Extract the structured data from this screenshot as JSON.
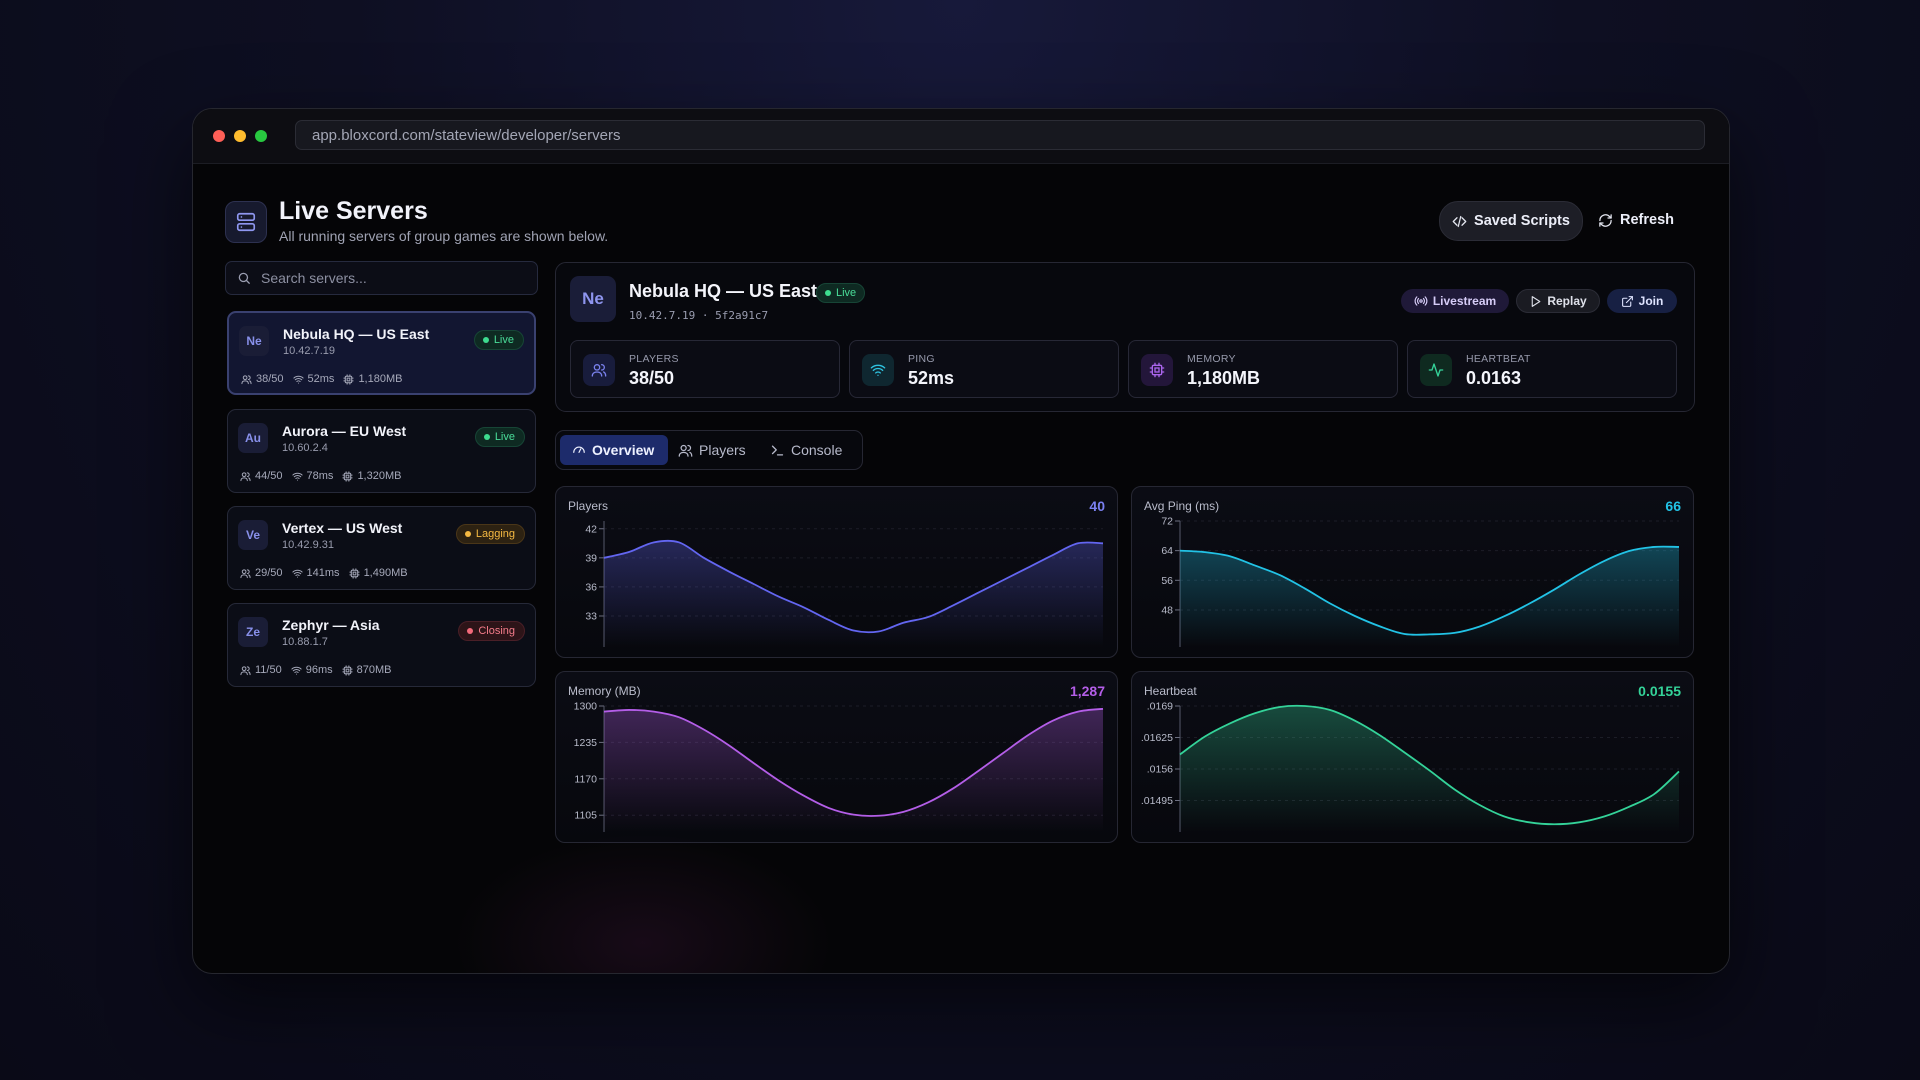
{
  "browser": {
    "url": "app.bloxcord.com/stateview/developer/servers"
  },
  "header": {
    "title": "Live Servers",
    "subtitle": "All running servers of group games are shown below.",
    "saved_scripts_label": "Saved Scripts",
    "refresh_label": "Refresh"
  },
  "search": {
    "placeholder": "Search servers..."
  },
  "servers": [
    {
      "initials": "Ne",
      "name": "Nebula HQ — US East",
      "ip": "10.42.7.19",
      "status": "Live",
      "players": "38/50",
      "ping": "52ms",
      "memory": "1,180MB"
    },
    {
      "initials": "Au",
      "name": "Aurora — EU West",
      "ip": "10.60.2.4",
      "status": "Live",
      "players": "44/50",
      "ping": "78ms",
      "memory": "1,320MB"
    },
    {
      "initials": "Ve",
      "name": "Vertex — US West",
      "ip": "10.42.9.31",
      "status": "Lagging",
      "players": "29/50",
      "ping": "141ms",
      "memory": "1,490MB"
    },
    {
      "initials": "Ze",
      "name": "Zephyr — Asia",
      "ip": "10.88.1.7",
      "status": "Closing",
      "players": "11/50",
      "ping": "96ms",
      "memory": "870MB"
    }
  ],
  "detail": {
    "initials": "Ne",
    "name": "Nebula HQ — US East",
    "status": "Live",
    "meta": "10.42.7.19 · 5f2a91c7",
    "actions": {
      "livestream": "Livestream",
      "replay": "Replay",
      "join": "Join"
    },
    "stats": [
      {
        "label": "PLAYERS",
        "value": "38/50",
        "icon": "users-icon",
        "color": "#6d74e8"
      },
      {
        "label": "PING",
        "value": "52ms",
        "icon": "wifi-icon",
        "color": "#22b8d8"
      },
      {
        "label": "MEMORY",
        "value": "1,180MB",
        "icon": "chip-icon",
        "color": "#a35be8"
      },
      {
        "label": "HEARTBEAT",
        "value": "0.0163",
        "icon": "pulse-icon",
        "color": "#2fc98a"
      }
    ]
  },
  "tabs": [
    {
      "label": "Overview",
      "icon": "gauge-icon",
      "active": true
    },
    {
      "label": "Players",
      "icon": "users-icon",
      "active": false
    },
    {
      "label": "Console",
      "icon": "terminal-icon",
      "active": false
    }
  ],
  "chart_data": [
    {
      "type": "area",
      "title": "Players",
      "current_value": "40",
      "color": "#6366f1",
      "x": [
        0,
        1,
        2,
        3,
        4,
        5,
        6,
        7,
        8,
        9,
        10,
        11,
        12,
        13,
        14,
        15,
        16,
        17,
        18,
        19,
        20
      ],
      "y": [
        39.0,
        39.6,
        40.6,
        40.6,
        39.0,
        37.6,
        36.3,
        35.0,
        33.9,
        32.6,
        31.5,
        31.4,
        32.3,
        32.9,
        34.1,
        35.4,
        36.7,
        38.0,
        39.3,
        40.5,
        40.5
      ],
      "ylim": [
        29.8,
        42.8
      ],
      "yticks": [
        "42",
        "39",
        "36",
        "33"
      ]
    },
    {
      "type": "area",
      "title": "Avg Ping (ms)",
      "current_value": "66",
      "color": "#22c3e6",
      "x": [
        0,
        1,
        2,
        3,
        4,
        5,
        6,
        7,
        8,
        9,
        10,
        11,
        12,
        13,
        14,
        15,
        16,
        17,
        18,
        19,
        20
      ],
      "y": [
        64.0,
        63.6,
        62.5,
        60.0,
        57.4,
        53.8,
        49.8,
        46.4,
        43.6,
        41.5,
        41.4,
        41.8,
        43.5,
        46.3,
        49.7,
        53.5,
        57.6,
        61.2,
        63.9,
        65.0,
        65.0
      ],
      "ylim": [
        38.0,
        72.0
      ],
      "yticks": [
        "72",
        "64",
        "56",
        "48"
      ]
    },
    {
      "type": "area",
      "title": "Memory (MB)",
      "current_value": "1,287",
      "color": "#b45ee8",
      "x": [
        0,
        1,
        2,
        3,
        4,
        5,
        6,
        7,
        8,
        9,
        10,
        11,
        12,
        13,
        14,
        15,
        16,
        17,
        18,
        19,
        20
      ],
      "y": [
        1290,
        1293,
        1290,
        1280,
        1258,
        1230,
        1198,
        1167,
        1140,
        1118,
        1106,
        1104,
        1111,
        1128,
        1153,
        1184,
        1216,
        1248,
        1274,
        1290,
        1295
      ],
      "ylim": [
        1075,
        1300
      ],
      "yticks": [
        "1300",
        "1235",
        "1170",
        "1105"
      ]
    },
    {
      "type": "area",
      "title": "Heartbeat",
      "current_value": "0.0155",
      "color": "#34d399",
      "x": [
        0,
        1,
        2,
        3,
        4,
        5,
        6,
        7,
        8,
        9,
        10,
        11,
        12,
        13,
        14,
        15,
        16,
        17,
        18,
        19,
        20
      ],
      "y": [
        0.0159,
        0.01627,
        0.01654,
        0.01675,
        0.01688,
        0.0169,
        0.01682,
        0.0166,
        0.0163,
        0.01594,
        0.01557,
        0.01518,
        0.01486,
        0.01462,
        0.0145,
        0.01446,
        0.0145,
        0.01462,
        0.01482,
        0.01508,
        0.01555
      ],
      "ylim": [
        0.0143,
        0.0169
      ],
      "yticks": [
        ".0169",
        ".01625",
        ".0156",
        ".01495"
      ]
    }
  ]
}
